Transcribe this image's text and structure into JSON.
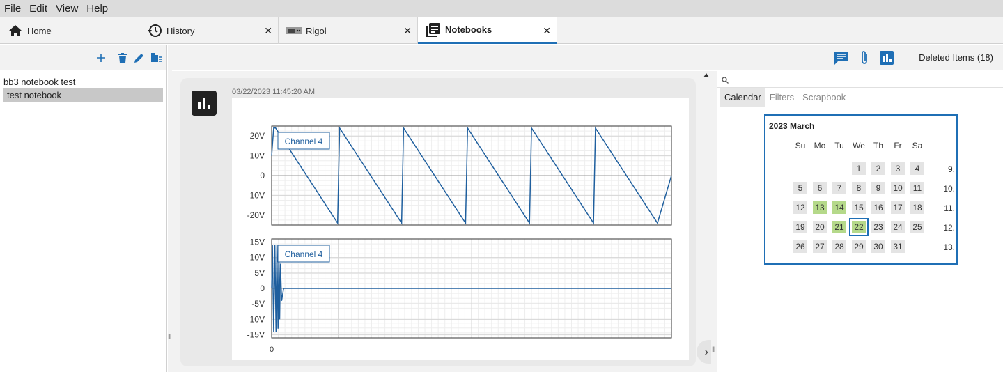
{
  "menu": {
    "items": [
      "File",
      "Edit",
      "View",
      "Help"
    ]
  },
  "tabs": [
    {
      "label": "Home",
      "icon": "home-icon",
      "closable": false
    },
    {
      "label": "History",
      "icon": "history-icon",
      "closable": true
    },
    {
      "label": "Rigol",
      "icon": "instrument-icon",
      "closable": true
    },
    {
      "label": "Notebooks",
      "icon": "notebook-icon",
      "closable": true,
      "active": true
    }
  ],
  "left_toolbar": {
    "icons": [
      "add-icon",
      "delete-icon",
      "edit-icon",
      "move-icon"
    ]
  },
  "notebooks": {
    "items": [
      {
        "label": "bb3 notebook test",
        "selected": false
      },
      {
        "label": "test notebook",
        "selected": true
      }
    ]
  },
  "center_toolbar": {
    "icons": [
      "comment-icon",
      "attachment-icon",
      "chart-icon"
    ],
    "deleted_label": "Deleted Items (18)"
  },
  "entry": {
    "timestamp": "03/22/2023 11:45:20 AM",
    "icon": "chart-icon"
  },
  "chart_data": [
    {
      "type": "line",
      "legend": "Channel 4",
      "yticks": [
        "20V",
        "10V",
        "0",
        "-10V",
        "-20V"
      ],
      "ylim": [
        -25,
        25
      ],
      "series": [
        {
          "name": "Channel 4",
          "x": [
            0,
            0.5,
            1.0,
            16.5,
            17.0,
            32.5,
            33.0,
            48.5,
            49.0,
            64.5,
            65.0,
            80.5,
            81.0,
            96.5,
            100
          ],
          "y": [
            10,
            24,
            24,
            -24,
            24,
            -24,
            24,
            -24,
            24,
            -24,
            24,
            -24,
            24,
            -24,
            0
          ]
        }
      ],
      "xlim": [
        0,
        100
      ],
      "color": "#1f5f9e"
    },
    {
      "type": "line",
      "legend": "Channel 4",
      "yticks": [
        "15V",
        "10V",
        "5V",
        "0",
        "-5V",
        "-10V",
        "-15V"
      ],
      "ylim": [
        -16,
        16
      ],
      "xticks": [
        "0"
      ],
      "series": [
        {
          "name": "Channel 4",
          "x": [
            0,
            0.2,
            0.5,
            0.8,
            1.1,
            1.3,
            1.6,
            1.8,
            2.0,
            2.2,
            2.5,
            3.0,
            100
          ],
          "y": [
            0,
            14,
            -14,
            14,
            -14,
            14,
            -13,
            12,
            -10,
            8,
            -4,
            0,
            0
          ]
        }
      ],
      "xlim": [
        0,
        100
      ],
      "color": "#1f5f9e"
    }
  ],
  "right_panel": {
    "search_placeholder": "",
    "tabs": [
      "Calendar",
      "Filters",
      "Scrapbook"
    ],
    "active_tab": "Calendar"
  },
  "calendar": {
    "title": "2023 March",
    "weekdays": [
      "Su",
      "Mo",
      "Tu",
      "We",
      "Th",
      "Fr",
      "Sa"
    ],
    "weeks": [
      {
        "num": "9.",
        "days": [
          "",
          "",
          "",
          "1",
          "2",
          "3",
          "4"
        ]
      },
      {
        "num": "10.",
        "days": [
          "5",
          "6",
          "7",
          "8",
          "9",
          "10",
          "11"
        ]
      },
      {
        "num": "11.",
        "days": [
          "12",
          "13",
          "14",
          "15",
          "16",
          "17",
          "18"
        ]
      },
      {
        "num": "12.",
        "days": [
          "19",
          "20",
          "21",
          "22",
          "23",
          "24",
          "25"
        ]
      },
      {
        "num": "13.",
        "days": [
          "26",
          "27",
          "28",
          "29",
          "30",
          "31",
          ""
        ]
      }
    ],
    "highlighted": [
      "13",
      "14",
      "21"
    ],
    "today": "22"
  }
}
